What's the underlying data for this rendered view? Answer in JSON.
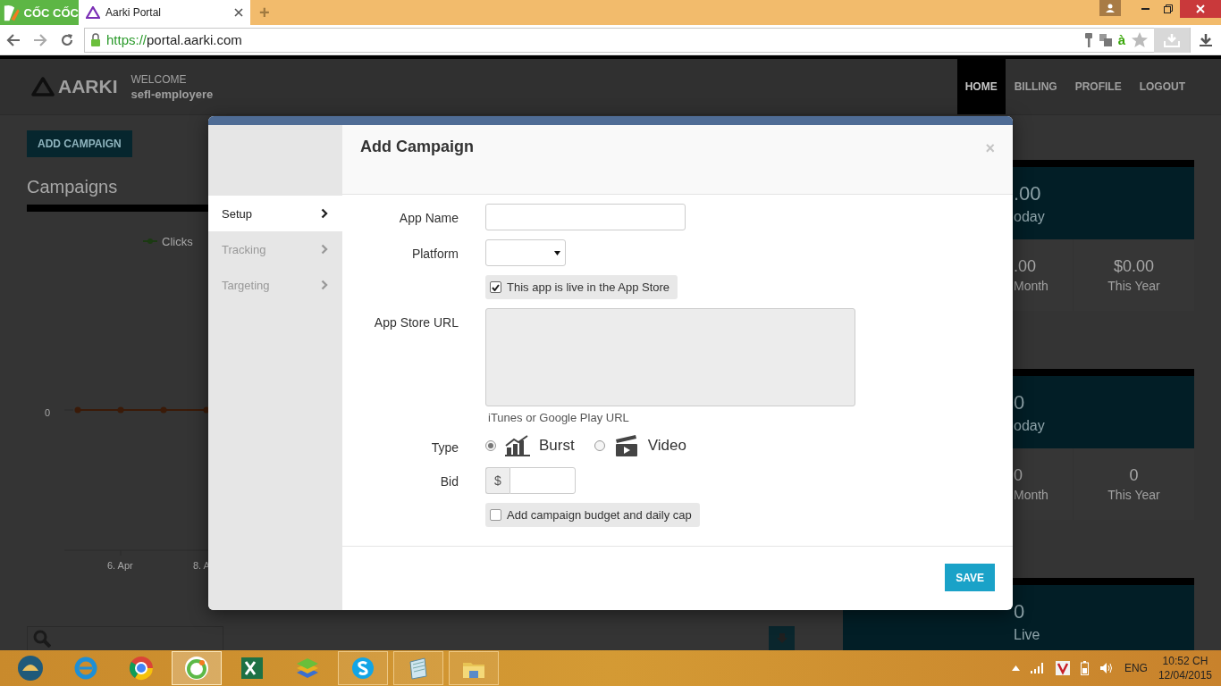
{
  "browser": {
    "brand": "CỐC CỐC",
    "tabs": [
      {
        "title": "Aarki Portal",
        "selected": true
      }
    ],
    "new_tab": "+",
    "url_scheme": "https://",
    "url_host": "portal.aarki.com",
    "extension_badge": "à"
  },
  "header": {
    "logo": "AARKI",
    "welcome": "WELCOME",
    "user": "sefl-employere",
    "nav": [
      {
        "label": "HOME",
        "selected": true
      },
      {
        "label": "BILLING",
        "selected": false
      },
      {
        "label": "PROFILE",
        "selected": false
      },
      {
        "label": "LOGOUT",
        "selected": false
      }
    ]
  },
  "dashboard": {
    "add_button": "ADD CAMPAIGN",
    "title": "Campaigns",
    "chart": {
      "legend": "Clicks",
      "y_tick": "0",
      "x_ticks": [
        "6. Apr",
        "8. A"
      ]
    },
    "cards": [
      {
        "value": ".00",
        "label": "oday",
        "cells": [
          {
            "value": ".00",
            "label": "Month"
          },
          {
            "value": "$0.00",
            "label": "This Year"
          }
        ]
      },
      {
        "value": "0",
        "label": "oday",
        "cells": [
          {
            "value": "0",
            "label": "Month"
          },
          {
            "value": "0",
            "label": "This Year"
          }
        ]
      },
      {
        "value": "0",
        "label": "Live"
      }
    ]
  },
  "modal": {
    "title": "Add Campaign",
    "close": "×",
    "steps": [
      {
        "label": "Setup",
        "selected": true
      },
      {
        "label": "Tracking",
        "selected": false
      },
      {
        "label": "Targeting",
        "selected": false
      }
    ],
    "fields": [
      {
        "kind": "text",
        "label": "App Name"
      },
      {
        "kind": "select",
        "label": "Platform"
      },
      {
        "kind": "checkbox",
        "text": "This app is live in the App Store",
        "checked": true
      },
      {
        "kind": "textarea",
        "label": "App Store URL",
        "help": "iTunes or Google Play URL"
      },
      {
        "kind": "radio",
        "label": "Type",
        "options": [
          {
            "text": "Burst",
            "selected": true
          },
          {
            "text": "Video",
            "selected": false
          }
        ]
      },
      {
        "kind": "money",
        "label": "Bid",
        "prefix": "$"
      },
      {
        "kind": "checkbox",
        "text": "Add campaign budget and daily cap",
        "checked": false
      }
    ],
    "save": "SAVE"
  },
  "taskbar": {
    "language": "ENG",
    "time": "10:52 CH",
    "date": "12/04/2015"
  }
}
